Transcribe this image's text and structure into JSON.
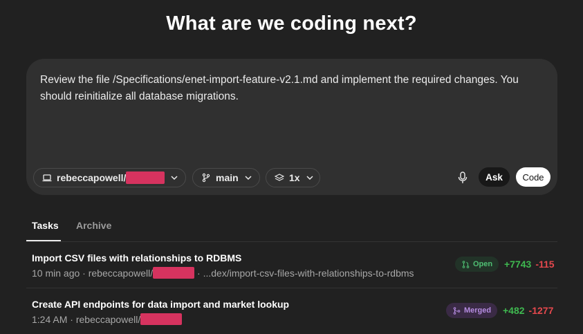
{
  "header": {
    "title": "What are we coding next?"
  },
  "composer": {
    "prompt": "Review the file /Specifications/enet-import-feature-v2.1.md and implement the required changes. You should reinitialize all database migrations.",
    "repo_label": "rebeccapowell/",
    "branch_label": "main",
    "versions_label": "1x",
    "ask_label": "Ask",
    "code_label": "Code"
  },
  "tabs": [
    {
      "label": "Tasks",
      "active": true
    },
    {
      "label": "Archive",
      "active": false
    }
  ],
  "tasks": [
    {
      "title": "Import CSV files with relationships to RDBMS",
      "time": "10 min ago",
      "repo": "rebeccapowell/",
      "branch": "...dex/import-csv-files-with-relationships-to-rdbms",
      "status": "Open",
      "additions": "+7743",
      "deletions": "-115"
    },
    {
      "title": "Create API endpoints for data import and market lookup",
      "time": "1:24 AM",
      "repo": "rebeccapowell/",
      "branch": "",
      "status": "Merged",
      "additions": "+482",
      "deletions": "-1277"
    }
  ],
  "colors": {
    "background": "#212121",
    "composer": "#303030",
    "redaction": "#d6335f",
    "additions": "#3fb950",
    "deletions": "#e5484d",
    "open_badge": "#4fbf73",
    "merged_badge": "#b58ce0"
  },
  "icons": [
    "laptop-icon",
    "branch-icon",
    "layers-icon",
    "chevron-down-icon",
    "microphone-icon",
    "pull-request-icon",
    "merge-icon"
  ]
}
